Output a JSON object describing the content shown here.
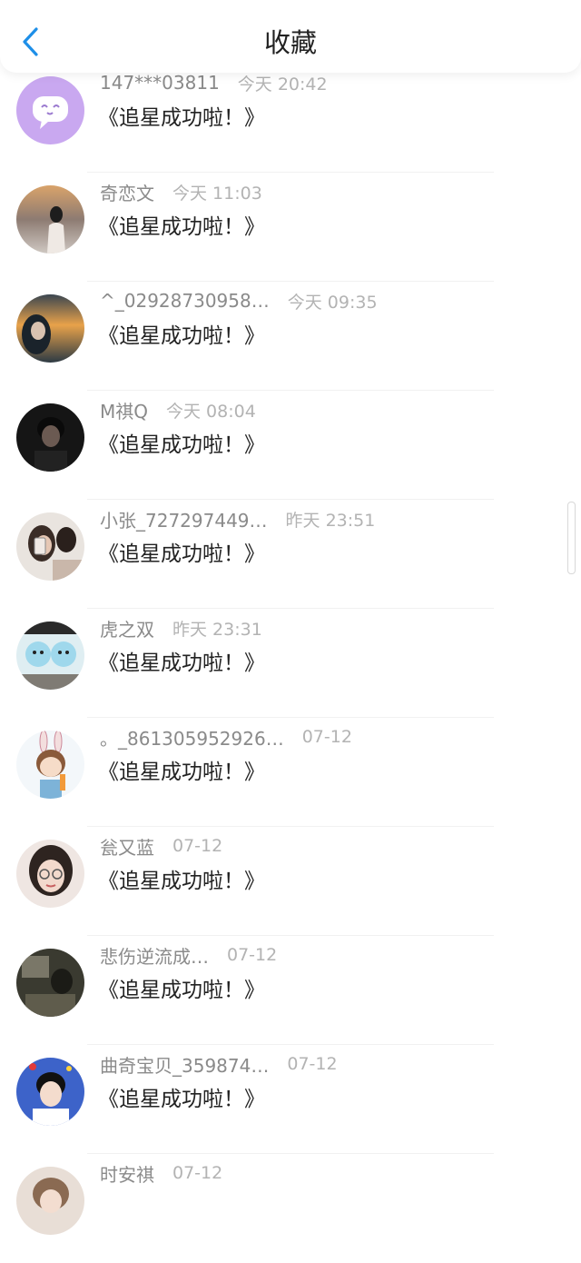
{
  "header": {
    "title": "收藏"
  },
  "items": [
    {
      "user": "147***03811",
      "time": "今天 20:42",
      "message": "《追星成功啦！》"
    },
    {
      "user": "奇恋文",
      "time": "今天 11:03",
      "message": "《追星成功啦！》"
    },
    {
      "user": "^_02928730958…",
      "time": "今天 09:35",
      "message": "《追星成功啦！》"
    },
    {
      "user": "M祺Q",
      "time": "今天 08:04",
      "message": "《追星成功啦！》"
    },
    {
      "user": "小张_727297449…",
      "time": "昨天 23:51",
      "message": "《追星成功啦！》"
    },
    {
      "user": "虎之双",
      "time": "昨天 23:31",
      "message": "《追星成功啦！》"
    },
    {
      "user": "。_861305952926…",
      "time": "07-12",
      "message": "《追星成功啦！》"
    },
    {
      "user": "瓮又蓝",
      "time": "07-12",
      "message": "《追星成功啦！》"
    },
    {
      "user": "悲伤逆流成…",
      "time": "07-12",
      "message": "《追星成功啦！》"
    },
    {
      "user": "曲奇宝贝_359874…",
      "time": "07-12",
      "message": "《追星成功啦！》"
    },
    {
      "user": "时安祺",
      "time": "07-12",
      "message": ""
    }
  ],
  "colors": {
    "accent": "#1e8fe8"
  },
  "icons": {
    "back": "chevron-left-icon",
    "chat": "chat-bubble-icon"
  }
}
